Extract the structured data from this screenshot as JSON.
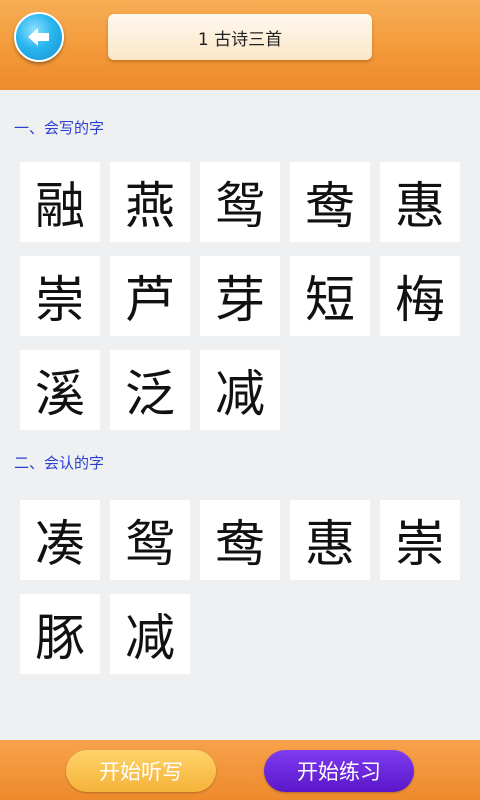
{
  "header": {
    "back_icon": "back-arrow-icon",
    "title": "1 古诗三首"
  },
  "sections": [
    {
      "title": "一、会写的字",
      "chars": [
        "融",
        "燕",
        "鸳",
        "鸯",
        "惠",
        "崇",
        "芦",
        "芽",
        "短",
        "梅",
        "溪",
        "泛",
        "减"
      ]
    },
    {
      "title": "二、会认的字",
      "chars": [
        "凑",
        "鸳",
        "鸯",
        "惠",
        "崇",
        "豚",
        "减"
      ]
    }
  ],
  "footer": {
    "dictation_label": "开始听写",
    "practice_label": "开始练习"
  },
  "colors": {
    "header_orange": "#f39a3a",
    "section_title_blue": "#2b3fd2",
    "dictation_button": "#f6b33a",
    "practice_button": "#5a16c8",
    "back_button_blue": "#29b6ee"
  }
}
